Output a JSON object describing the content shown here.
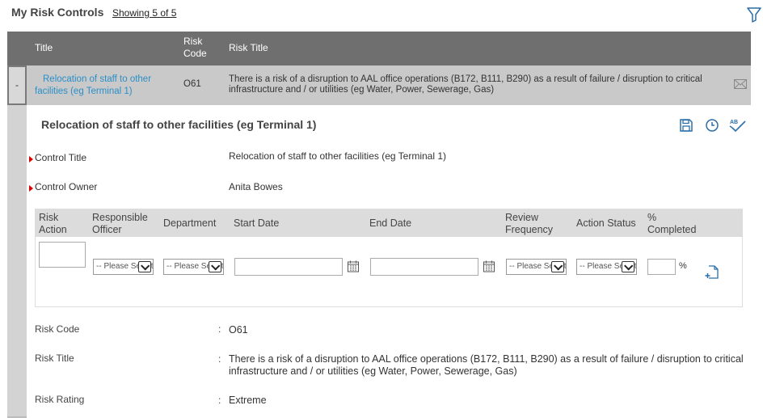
{
  "header": {
    "title": "My Risk Controls",
    "showing": "Showing 5 of 5",
    "filter_icon": "filter-icon"
  },
  "grid": {
    "columns": [
      "Title",
      "Risk Code",
      "Risk Title"
    ],
    "column_code_line1": "Risk",
    "column_code_line2": "Code",
    "rows": [
      {
        "toggle": "-",
        "title": "Relocation of staff to other facilities (eg Terminal 1)",
        "risk_code": "O61",
        "risk_title": "There is a risk of a disruption to AAL office operations (B172, B111, B290) as a result of failure / disruption to critical infrastructure and / or utilities (eg Water, Power, Sewerage, Gas)",
        "icon": "mail-icon"
      }
    ]
  },
  "detail": {
    "title": "Relocation of staff to other facilities (eg Terminal 1)",
    "actions": [
      "save-icon",
      "history-icon",
      "spellcheck-icon"
    ],
    "fields": {
      "control_title_label": "Control Title",
      "control_title_value": "Relocation of staff to other facilities (eg Terminal 1)",
      "control_owner_label": "Control Owner",
      "control_owner_value": "Anita Bowes"
    },
    "action_table": {
      "headers": {
        "risk_action_1": "Risk",
        "risk_action_2": "Action",
        "responsible_officer_1": "Responsible",
        "responsible_officer_2": "Officer",
        "department": "Department",
        "start_date": "Start Date",
        "end_date": "End Date",
        "review_frequency_1": "Review",
        "review_frequency_2": "Frequency",
        "action_status": "Action Status",
        "pct_completed_1": "%",
        "pct_completed_2": "Completed"
      },
      "select_placeholder": "-- Please Select --",
      "percent_sign": "%"
    },
    "info": {
      "risk_code_label": "Risk Code",
      "risk_code_value": "O61",
      "risk_title_label": "Risk Title",
      "risk_title_value": "There is a risk of a disruption to AAL office operations (B172, B111, B290) as a result of failure / disruption to critical infrastructure and / or utilities (eg Water, Power, Sewerage, Gas)",
      "risk_rating_label": "Risk Rating",
      "risk_rating_value": "Extreme",
      "colon": ":"
    }
  },
  "colors": {
    "header_bg": "#6f6f6f",
    "row_bg": "#c9c9c9",
    "link": "#2a8fc8",
    "required": "#dd0000"
  }
}
